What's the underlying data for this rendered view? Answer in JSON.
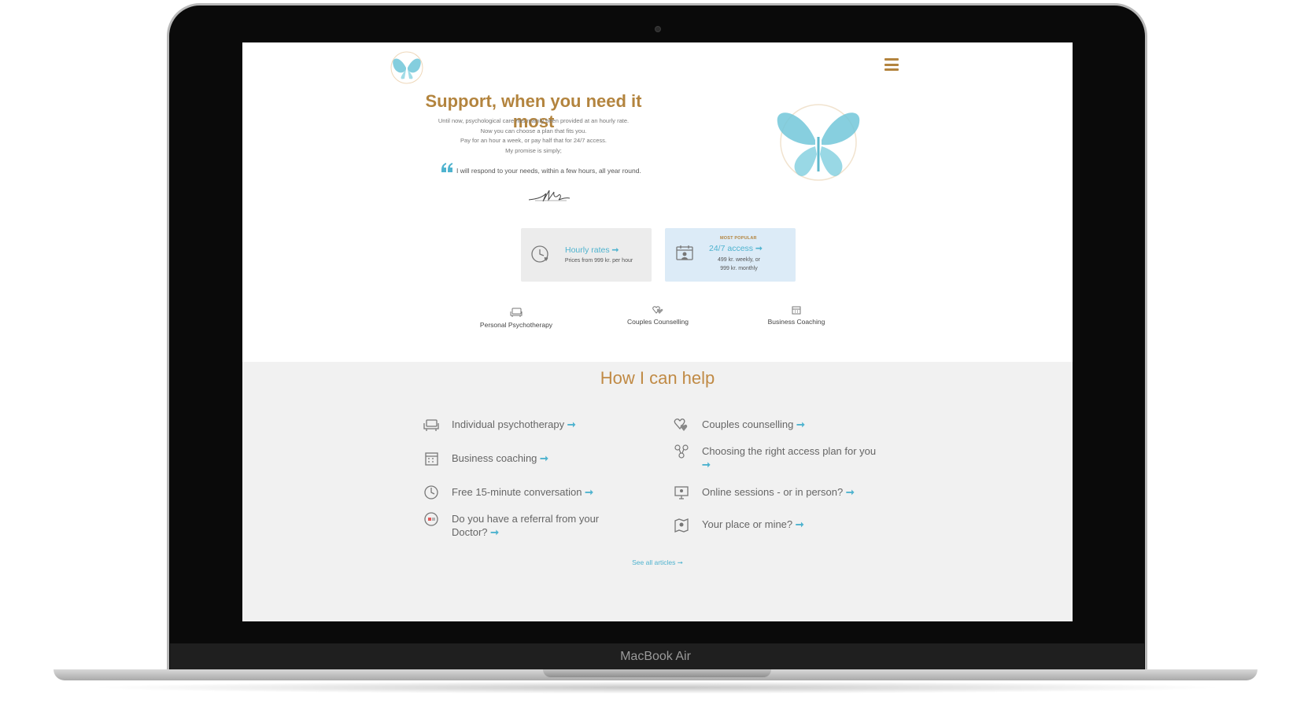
{
  "device": {
    "label": "MacBook Air"
  },
  "hero": {
    "title": "Support, when you need it most",
    "lines": [
      "Until now, psychological care has mainly been provided at an hourly rate.",
      "Now you can choose a plan that fits you.",
      "Pay for an hour a week, or pay half that for 24/7 access.",
      "My promise is simply;"
    ],
    "quote": "I will respond to your needs, within a few hours, all year round."
  },
  "plans": {
    "hourly": {
      "title": "Hourly rates",
      "arrow": "➞",
      "subtitle": "Prices from 999 kr. per hour",
      "icon": "clock-heart-icon"
    },
    "access": {
      "badge": "MOST POPULAR",
      "title": "24/7 access",
      "arrow": "➞",
      "subtitle_line1": "499 kr. weekly, or",
      "subtitle_line2": "999 kr. monthly",
      "icon": "calendar-person-icon"
    }
  },
  "services": [
    {
      "label": "Personal Psychotherapy",
      "icon": "couch-icon"
    },
    {
      "label": "Couples Counselling",
      "icon": "hearts-icon"
    },
    {
      "label": "Business Coaching",
      "icon": "calendar-icon"
    }
  ],
  "help": {
    "title": "How I can help",
    "items_left": [
      {
        "label": "Individual psychotherapy",
        "icon": "couch-icon"
      },
      {
        "label": "Business coaching",
        "icon": "calendar-icon"
      },
      {
        "label": "Free 15-minute conversation",
        "icon": "clock-icon"
      },
      {
        "label_line1": "Do you have a referral from your",
        "label_line2": "Doctor?",
        "icon": "referral-icon"
      }
    ],
    "items_right": [
      {
        "label": "Couples counselling",
        "icon": "hearts-icon"
      },
      {
        "label": "Choosing the right access plan for you",
        "icon": "options-icon"
      },
      {
        "label": "Online sessions - or in person?",
        "icon": "monitor-icon"
      },
      {
        "label": "Your place or mine?",
        "icon": "map-icon"
      }
    ],
    "arrow": "➞",
    "see_all": "See all articles ➞"
  },
  "colors": {
    "accent_gold": "#b3843e",
    "accent_teal": "#4fb3cf",
    "section_grey": "#f1f1f1",
    "popular_blue": "#dcebf7"
  }
}
